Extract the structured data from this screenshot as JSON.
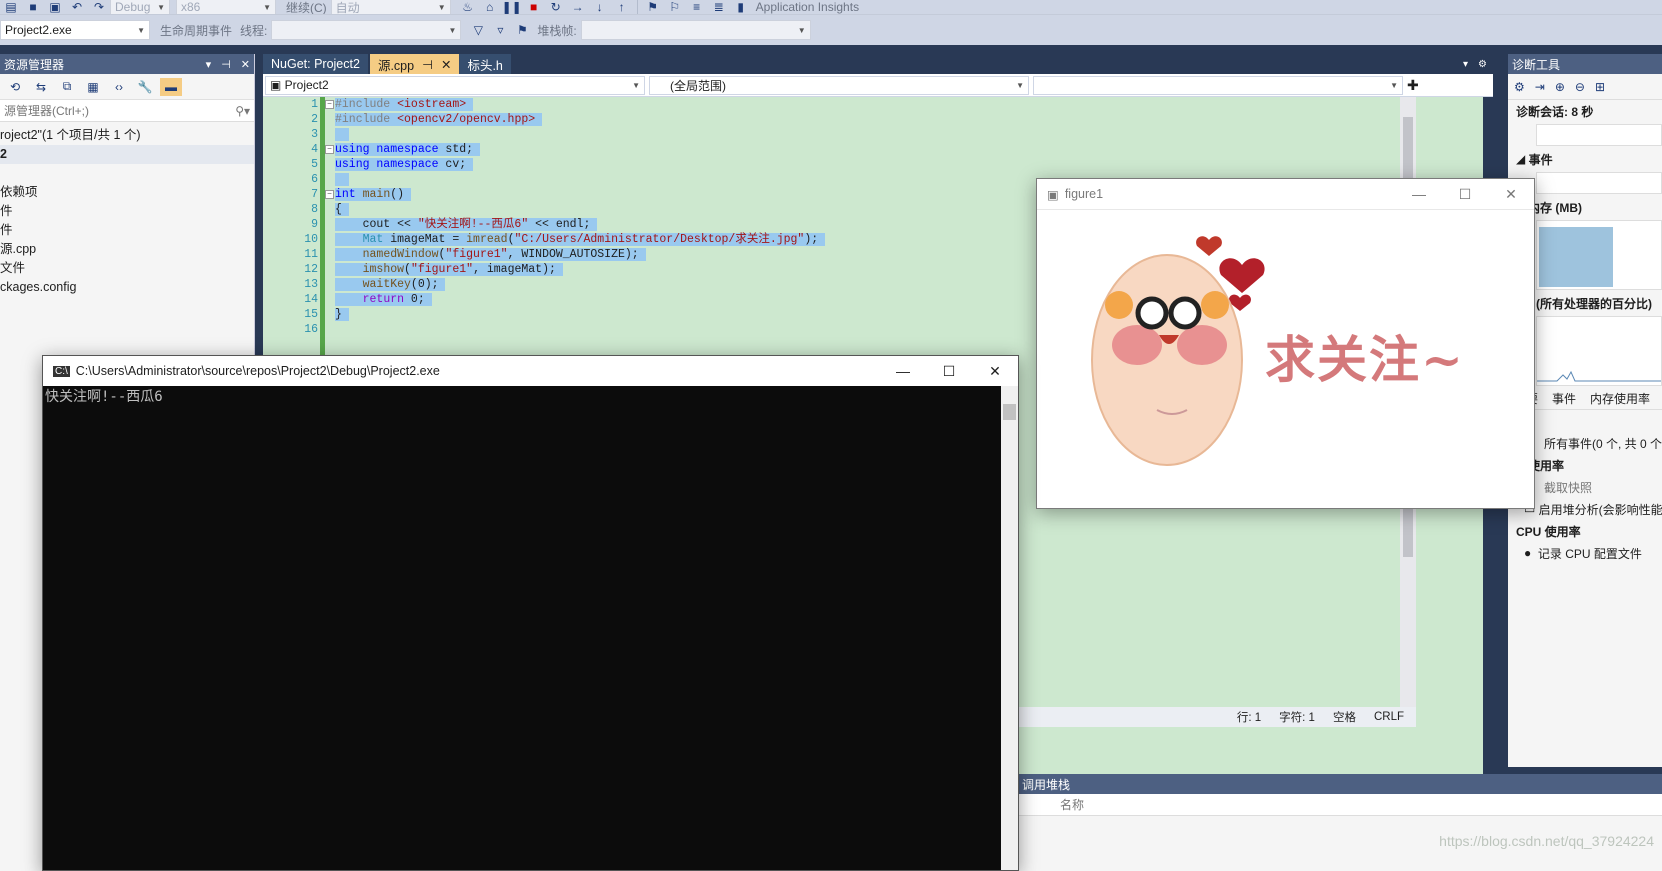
{
  "toolbar": {
    "config": "Debug",
    "platform": "x86",
    "continue_label": "继续(C)",
    "auto_label": "自动",
    "insights_label": "Application Insights",
    "process_value": "Project2.exe",
    "lifecycle_label": "生命周期事件",
    "thread_label": "线程:",
    "stackframe_label": "堆栈帧:"
  },
  "solution": {
    "title": "资源管理器",
    "search_placeholder": "源管理器(Ctrl+;)",
    "items": [
      "roject2\"(1 个项目/共 1 个)",
      "2",
      "",
      "依赖项",
      "件",
      "件",
      "源.cpp",
      "文件",
      "ckages.config"
    ]
  },
  "editor": {
    "tabs": [
      {
        "label": "NuGet: Project2",
        "active": false
      },
      {
        "label": "源.cpp",
        "active": true
      },
      {
        "label": "标头.h",
        "active": false
      }
    ],
    "nav_project": "Project2",
    "nav_scope": "(全局范围)",
    "line_numbers": [
      "1",
      "2",
      "3",
      "4",
      "5",
      "6",
      "7",
      "8",
      "9",
      "10",
      "11",
      "12",
      "13",
      "14",
      "15",
      "16"
    ],
    "status": {
      "line": "行: 1",
      "char": "字符: 1",
      "space": "空格",
      "eol": "CRLF"
    }
  },
  "figure": {
    "title": "figure1",
    "image_text": "求关注~"
  },
  "console": {
    "title": "C:\\Users\\Administrator\\source\\repos\\Project2\\Debug\\Project2.exe",
    "output": "快关注啊!--西瓜6"
  },
  "diagnostics": {
    "title": "诊断工具",
    "session": "诊断会话: 8 秒",
    "events_label": "事件",
    "memory_label": "程内存 (MB)",
    "cpu_label": "PU (所有处理器的百分比)",
    "tabs": [
      "要",
      "事件",
      "内存使用率"
    ],
    "events_row": "件",
    "all_events": "所有事件(0 个, 共 0 个)",
    "mem_usage": "存使用率",
    "snapshot": "截取快照",
    "heap_analysis": "启用堆分析(会影响性能)",
    "cpu_usage": "CPU 使用率",
    "record_cpu": "记录 CPU 配置文件"
  },
  "callstack": {
    "title": "调用堆栈",
    "col_name": "名称"
  },
  "watermark": "https://blog.csdn.net/qq_37924224",
  "colors": {
    "chrome": "#293955",
    "editor_bg": "#cde8cf",
    "selection": "#99c9ef",
    "active_tab": "#f5cc84"
  }
}
